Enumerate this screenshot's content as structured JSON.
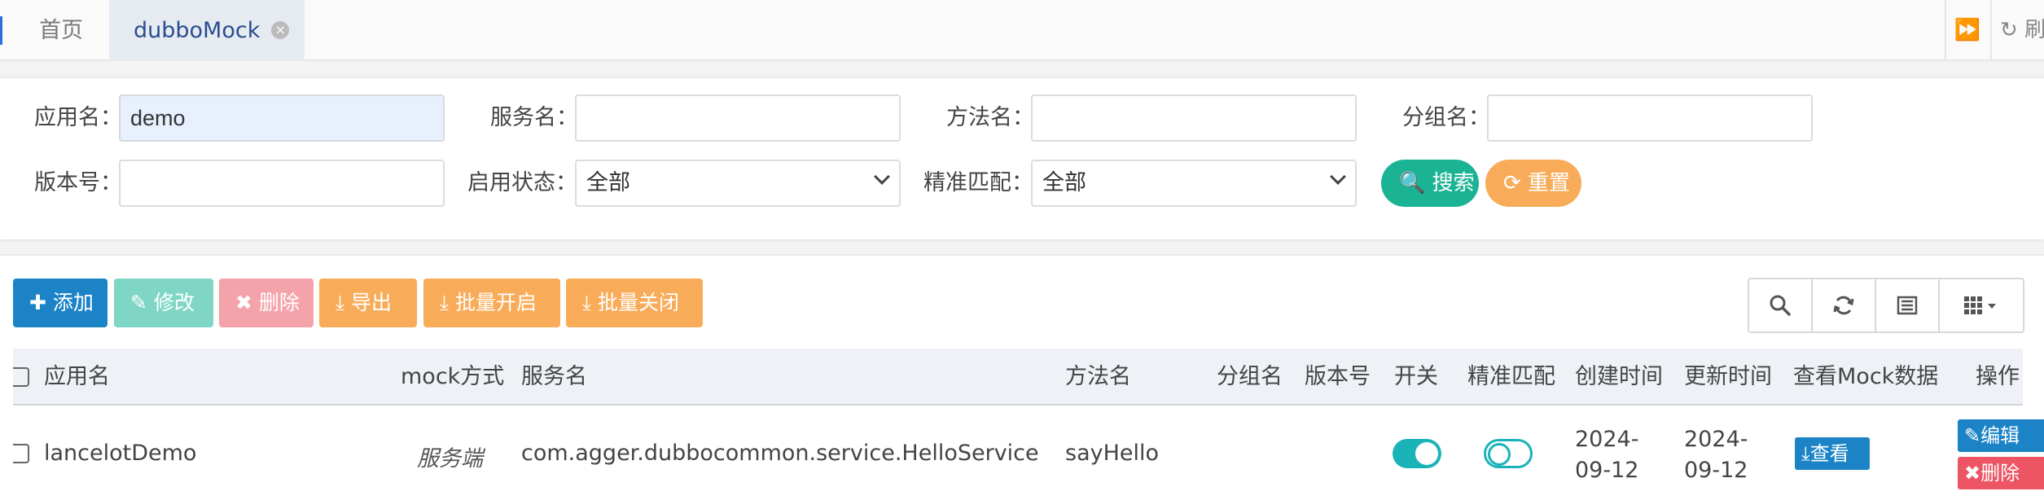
{
  "tabs": {
    "home": "首页",
    "active": "dubboMock",
    "close_glyph": "×",
    "forward_glyph": "⏩",
    "refresh": "↻ 刷"
  },
  "search": {
    "app_label": "应用名：",
    "app_value": "demo",
    "service_label": "服务名：",
    "service_value": "",
    "method_label": "方法名：",
    "method_value": "",
    "group_label": "分组名：",
    "group_value": "",
    "version_label": "版本号：",
    "version_value": "",
    "enable_label": "启用状态：",
    "enable_value": "全部",
    "exact_label": "精准匹配：",
    "exact_value": "全部",
    "search_button": "🔍 搜索",
    "reset_button": "⟳ 重置"
  },
  "toolbar": {
    "add": "✚ 添加",
    "edit": "✎ 修改",
    "delete": "✖ 删除",
    "export": "⤓ 导出",
    "batch_on": "⤓ 批量开启",
    "batch_off": "⤓ 批量关闭",
    "icons": [
      "search-icon",
      "refresh-icon",
      "list-icon",
      "columns-icon"
    ]
  },
  "table": {
    "headers": {
      "app": "应用名",
      "mock_type": "mock方式",
      "service": "服务名",
      "method": "方法名",
      "group": "分组名",
      "version": "版本号",
      "switch": "开关",
      "exact": "精准匹配",
      "created": "创建时间",
      "updated": "更新时间",
      "view_mock": "查看Mock数据",
      "ops": "操作"
    },
    "rows": [
      {
        "app": "lancelotDemo",
        "mock_type": "服务端",
        "service": "com.agger.dubbocommon.service.HelloService",
        "method": "sayHello",
        "group": "",
        "version": "",
        "switch_on": true,
        "exact_on": false,
        "created_line1": "2024-",
        "created_line2": "09-12",
        "updated_line1": "2024-",
        "updated_line2": "09-12",
        "view_button": "⤓查看",
        "edit_button": "✎编辑",
        "delete_button": "✖删除"
      }
    ]
  },
  "colors": {
    "primary": "#1c84c6",
    "success": "#1ab394",
    "warning": "#f8ac59",
    "danger": "#ed5565",
    "toggle": "#1ab3b8"
  }
}
